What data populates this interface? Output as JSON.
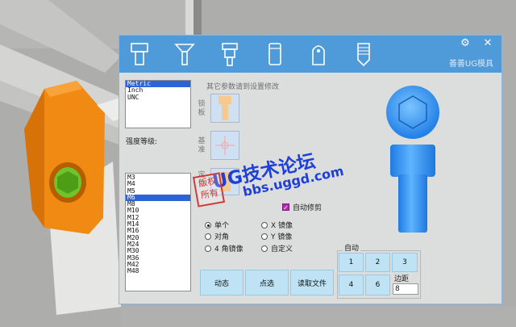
{
  "toolbar": {
    "title": "善善UG模具",
    "tools": [
      {
        "name": "socket-head-screw-icon"
      },
      {
        "name": "countersunk-screw-icon"
      },
      {
        "name": "shoulder-screw-icon"
      },
      {
        "name": "dowel-pin-icon"
      },
      {
        "name": "pull-pin-icon"
      },
      {
        "name": "threaded-insert-icon"
      }
    ],
    "settings_icon": "⚙",
    "close_icon": "✕"
  },
  "unit_list": {
    "items": [
      "Metric",
      "Inch",
      "UNC"
    ],
    "selected": "Metric"
  },
  "grade_label": "强度等级:",
  "size_list": {
    "items": [
      "M3",
      "M4",
      "M5",
      "M6",
      "M8",
      "M10",
      "M12",
      "M14",
      "M16",
      "M20",
      "M24",
      "M30",
      "M36",
      "M42",
      "M48"
    ],
    "selected": "M6"
  },
  "hint": "其它参数请到设置修改",
  "side_labels": {
    "lock": "锁板",
    "base": "基准",
    "position": "定位"
  },
  "auto_trim": {
    "label": "自动修剪",
    "checked": true
  },
  "layout_options": {
    "single": "单个",
    "diagonal": "对角",
    "four_mirror": "4 角镜像",
    "x_mirror": "X 镜像",
    "y_mirror": "Y 镜像",
    "custom": "自定义",
    "selected": "single"
  },
  "auto_group": {
    "label": "自动",
    "buttons": [
      "1",
      "2",
      "3",
      "4",
      "6"
    ],
    "margin_label": "边距",
    "margin_value": "8"
  },
  "actions": {
    "dynamic": "动态",
    "point": "点选",
    "read_file": "读取文件"
  },
  "watermark": {
    "text": "UG技术论坛",
    "url": "bbs.uggd.com",
    "stamp": "版权所有"
  },
  "colors": {
    "header": "#4f9ad9",
    "accent_button": "#bfe3f5",
    "selection": "#2b63d8",
    "preview": "#2f8df0"
  }
}
